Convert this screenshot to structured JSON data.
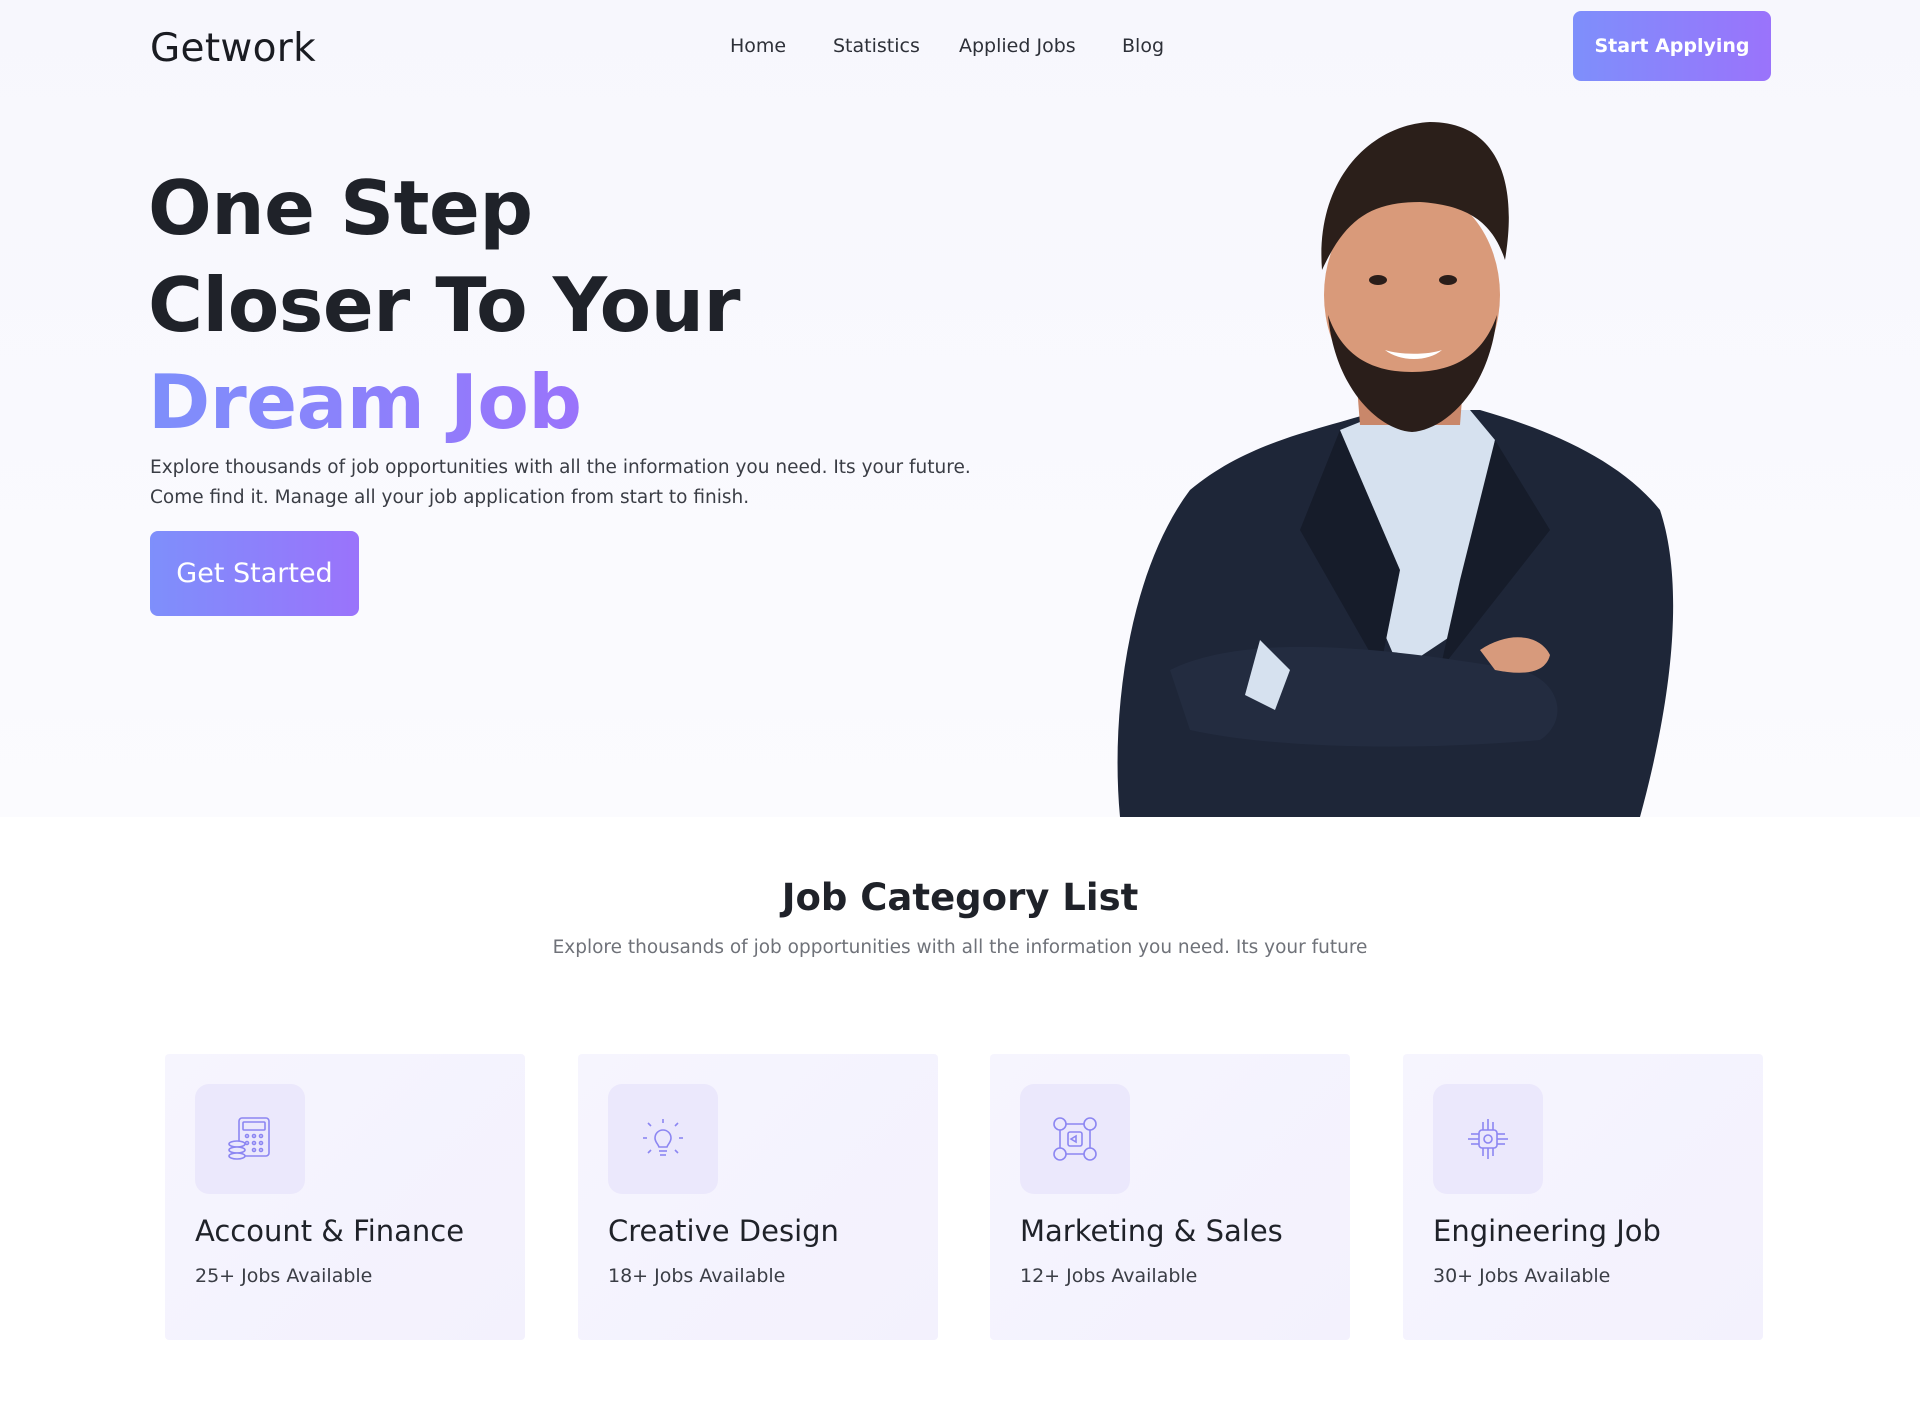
{
  "header": {
    "logo": "Getwork",
    "nav": [
      "Home",
      "Statistics",
      "Applied Jobs",
      "Blog"
    ],
    "cta": "Start Applying"
  },
  "hero": {
    "line1": "One Step",
    "line2": "Closer To Your",
    "line3": "Dream Job",
    "description": "Explore thousands of job opportunities with all the information you need. Its your future. Come find it. Manage all your job application from start to finish.",
    "button": "Get Started"
  },
  "categories": {
    "title": "Job Category List",
    "subtitle": "Explore thousands of job opportunities with all the information you need. Its your future",
    "items": [
      {
        "title": "Account & Finance",
        "count": "25+ Jobs Available",
        "icon": "calculator-coins-icon"
      },
      {
        "title": "Creative Design",
        "count": "18+ Jobs Available",
        "icon": "lightbulb-icon"
      },
      {
        "title": "Marketing & Sales",
        "count": "12+ Jobs Available",
        "icon": "social-marketing-icon"
      },
      {
        "title": "Engineering Job",
        "count": "30+ Jobs Available",
        "icon": "circuit-chip-icon"
      }
    ]
  },
  "colors": {
    "accent_start": "#7e8ffb",
    "accent_end": "#9a73fb",
    "text_dark": "#1f2229",
    "hero_bg": "#f7f7fd",
    "card_bg": "#f4f3fe"
  }
}
